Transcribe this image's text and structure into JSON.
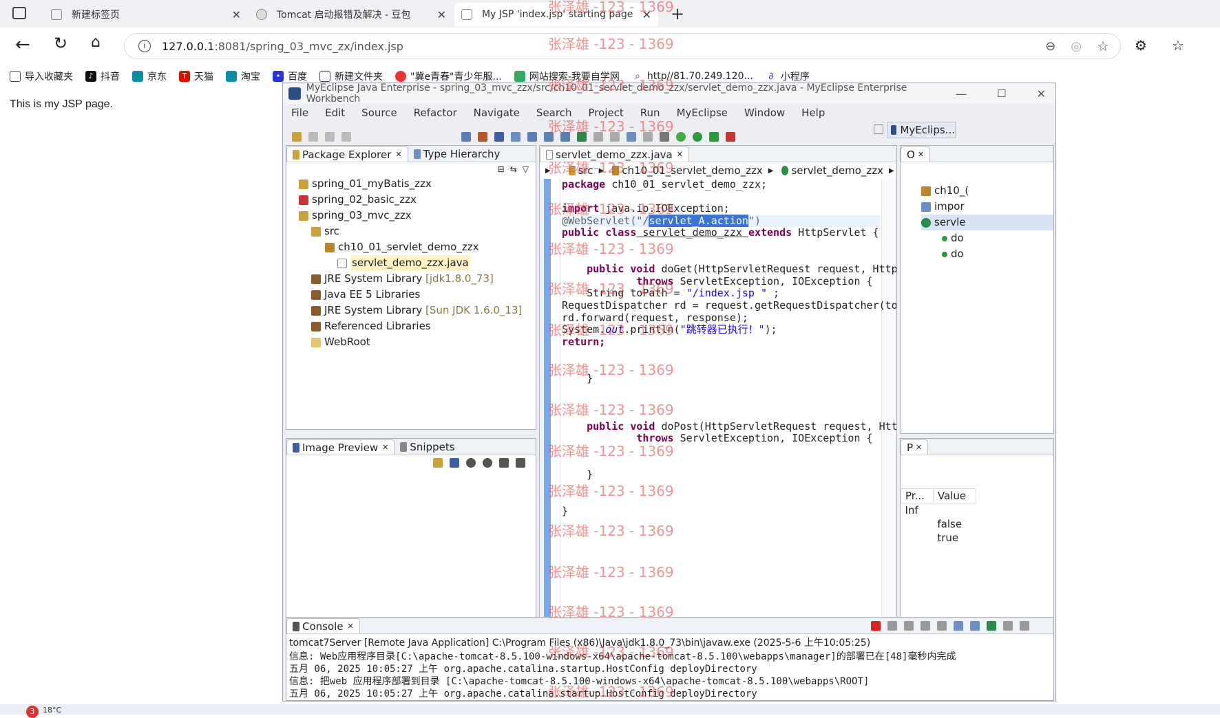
{
  "browser": {
    "tabs": [
      {
        "label": "新建标签页"
      },
      {
        "label": "Tomcat 启动报错及解决 - 豆包"
      },
      {
        "label": "My JSP 'index.jsp' starting page"
      }
    ],
    "address_host": "127.0.0.1",
    "address_path": ":8081/spring_03_mvc_zx/index.jsp",
    "bookmarks": [
      "导入收藏夹",
      "抖音",
      "京东",
      "天猫",
      "淘宝",
      "百度",
      "新建文件夹",
      "\"冀e青春\"青少年服...",
      "网站搜索-我要自学网",
      "http//81.70.249.120...",
      "小程序"
    ]
  },
  "page": {
    "text": "This is my JSP page."
  },
  "eclipse": {
    "title": "MyEclipse Java Enterprise - spring_03_mvc_zzx/src/ch10_01_servlet_demo_zzx/servlet_demo_zzx.java - MyEclipse Enterprise Workbench",
    "menu": [
      "File",
      "Edit",
      "Source",
      "Refactor",
      "Navigate",
      "Search",
      "Project",
      "Run",
      "MyEclipse",
      "Window",
      "Help"
    ],
    "perspective": "MyEclips...",
    "explorer_tabs": [
      "Package Explorer",
      "Type Hierarchy"
    ],
    "tree": [
      {
        "label": "spring_01_myBatis_zzx",
        "extra": ""
      },
      {
        "label": "spring_02_basic_zzx",
        "extra": ""
      },
      {
        "label": "spring_03_mvc_zzx",
        "extra": ""
      },
      {
        "label": "src",
        "extra": ""
      },
      {
        "label": "ch10_01_servlet_demo_zzx",
        "extra": ""
      },
      {
        "label": "servlet_demo_zzx.java",
        "extra": ""
      },
      {
        "label": "JRE System Library",
        "extra": "[jdk1.8.0_73]"
      },
      {
        "label": "Java EE 5 Libraries",
        "extra": ""
      },
      {
        "label": "JRE System Library",
        "extra": "[Sun JDK 1.6.0_13]"
      },
      {
        "label": "Referenced Libraries",
        "extra": ""
      },
      {
        "label": "WebRoot",
        "extra": ""
      }
    ],
    "preview_tabs": [
      "Image Preview",
      "Snippets"
    ],
    "editor_tab": "servlet_demo_zzx.java",
    "breadcrumb": [
      "src",
      "ch10_01_servlet_demo_zzx",
      "servlet_demo_zzx"
    ],
    "code": {
      "package_kw": "package",
      "package_name": " ch10_01_servlet_demo_zzx;",
      "import_kw": "import",
      "import_name": " java.io.IOException;",
      "annotation_pre": "@WebServlet(\"/",
      "annotation_sel": "servlet_A.action",
      "annotation_post": "\")",
      "class_line_kw1": "public class",
      "class_line_name": " servlet_demo_zzx ",
      "class_line_kw2": "extends",
      "class_line_end": " HttpServlet {",
      "doget_kw": "public void",
      "doget_sig": " doGet(HttpServletRequest request, HttpServ",
      "throws_kw": "throws",
      "throws_rest": " ServletException, IOException {",
      "l_topath_a": "String toPath = ",
      "l_topath_str": "\"/index.jsp \"",
      "l_topath_b": " ;",
      "l_rd": "RequestDispatcher rd = request.getRequestDispatcher(toPath",
      "l_fwd": "rd.forward(request, response);",
      "l_sys_a": "System.",
      "l_sys_out": "out",
      "l_sys_b": ".println(",
      "l_sys_str": "\"跳转器已执行！\"",
      "l_sys_c": ");",
      "l_ret": "return;",
      "brace": "}",
      "dopost_kw": "public void",
      "dopost_sig": " doPost(HttpServletRequest request, HttpSer"
    },
    "outline_tab": "O",
    "outline_items": [
      "ch10_(",
      "impor",
      "servle",
      "do",
      "do"
    ],
    "props_tab": "P",
    "props_cols": [
      "Pr...",
      "Value"
    ],
    "props_rows": [
      [
        "Inf",
        ""
      ],
      [
        "",
        "false"
      ],
      [
        "",
        "true"
      ]
    ],
    "console_tab": "Console",
    "console_header": "tomcat7Server [Remote Java Application] C:\\Program Files (x86)\\Java\\jdk1.8.0_73\\bin\\javaw.exe (2025-5-6 上午10:05:25)",
    "console_lines": [
      "信息: Web应用程序目录[C:\\apache-tomcat-8.5.100-windows-x64\\apache-tomcat-8.5.100\\webapps\\manager]的部署已在[48]毫秒内完成",
      "五月 06, 2025 10:05:27 上午 org.apache.catalina.startup.HostConfig deployDirectory",
      "信息: 把web 应用程序部署到目录 [C:\\apache-tomcat-8.5.100-windows-x64\\apache-tomcat-8.5.100\\webapps\\ROOT]",
      "五月 06, 2025 10:05:27 上午 org.apache.catalina.startup.HostConfig deployDirectory"
    ]
  },
  "watermark": "张泽雄 -123 - 1369",
  "taskbar": {
    "weather": "18°C",
    "badge": "3"
  }
}
